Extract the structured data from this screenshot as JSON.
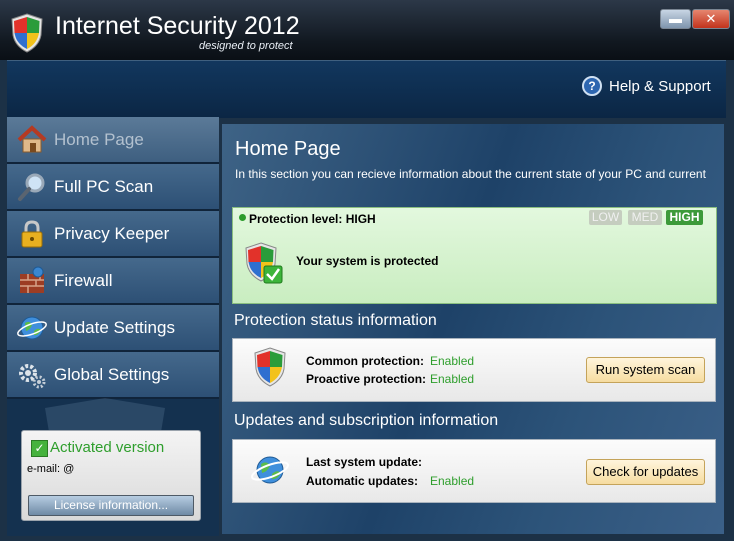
{
  "app": {
    "title": "Internet Security 2012",
    "tagline": "designed to protect"
  },
  "window_controls": {
    "minimize": "▬",
    "close": "✕"
  },
  "header": {
    "help_label": "Help & Support",
    "help_icon": "question-icon"
  },
  "sidebar": {
    "items": [
      {
        "label": "Home Page",
        "icon": "house-icon",
        "active": true
      },
      {
        "label": "Full PC Scan",
        "icon": "magnifier-icon",
        "active": false
      },
      {
        "label": "Privacy Keeper",
        "icon": "padlock-icon",
        "active": false
      },
      {
        "label": "Firewall",
        "icon": "brick-wall-icon",
        "active": false
      },
      {
        "label": "Update Settings",
        "icon": "globe-icon",
        "active": false
      },
      {
        "label": "Global Settings",
        "icon": "gears-icon",
        "active": false
      }
    ],
    "activation": {
      "status": "Activated version",
      "email_label": "e-mail:",
      "email_value": "@",
      "license_button": "License information..."
    }
  },
  "main": {
    "title": "Home Page",
    "description": "In this section you can recieve information about the current state of your PC and current",
    "protection": {
      "level_label": "Protection level: HIGH",
      "levels": [
        "LOW",
        "MED",
        "HIGH"
      ],
      "selected_level": "HIGH",
      "message": "Your system is protected"
    },
    "status_section": {
      "heading": "Protection status information",
      "rows": [
        {
          "label": "Common protection:",
          "value": "Enabled"
        },
        {
          "label": "Proactive protection:",
          "value": "Enabled"
        }
      ],
      "button": "Run system scan"
    },
    "updates_section": {
      "heading": "Updates and subscription information",
      "rows": [
        {
          "label": "Last system update:",
          "value": ""
        },
        {
          "label": "Automatic updates:",
          "value": "Enabled"
        }
      ],
      "button": "Check for updates"
    }
  },
  "colors": {
    "enabled_green": "#2e9e2c",
    "active_level": "#3d9a3a",
    "sidebar_bg": "#2d5075"
  }
}
